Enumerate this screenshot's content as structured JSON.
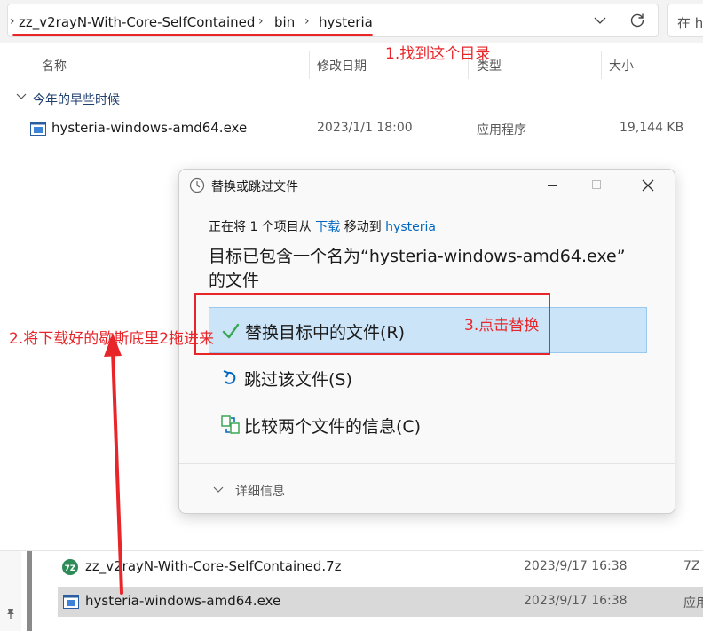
{
  "breadcrumb": {
    "items": [
      "zz_v2rayN-With-Core-SelfContained",
      "bin",
      "hysteria"
    ]
  },
  "search": {
    "placeholder": "在 h"
  },
  "columns": {
    "name": "名称",
    "modified": "修改日期",
    "type": "类型",
    "size": "大小"
  },
  "group": {
    "label": "今年的早些时候"
  },
  "top_file": {
    "name": "hysteria-windows-amd64.exe",
    "date": "2023/1/1 18:00",
    "type": "应用程序",
    "size": "19,144 KB"
  },
  "dialog": {
    "title": "替换或跳过文件",
    "line1_prefix": "正在将 1 个项目从",
    "line1_source": "下载",
    "line1_mid": "移动到",
    "line1_dest": "hysteria",
    "heading_line1": "目标已包含一个名为“hysteria-windows-amd64.exe”",
    "heading_line2": "的文件",
    "options": {
      "replace": "替换目标中的文件(R)",
      "skip": "跳过该文件(S)",
      "compare": "比较两个文件的信息(C)"
    },
    "details": "详细信息"
  },
  "annotations": {
    "step1": "1.找到这个目录",
    "step2": "2.将下载好的歇斯底里2拖进来",
    "step3": "3.点击替换"
  },
  "bottom_files": [
    {
      "name": "zz_v2rayN-With-Core-SelfContained.7z",
      "date": "2023/9/17 16:38",
      "type": "7Z"
    },
    {
      "name": "hysteria-windows-amd64.exe",
      "date": "2023/9/17 16:38",
      "type": "应用"
    }
  ],
  "colors": {
    "annotation_red": "#e8262a",
    "link_blue": "#0067c0",
    "selection_blue": "#cce4f7"
  }
}
